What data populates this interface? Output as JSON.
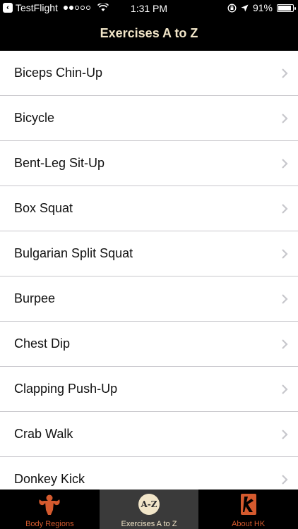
{
  "status_bar": {
    "back_app": "TestFlight",
    "time": "1:31 PM",
    "battery": "91%",
    "battery_level": 0.91
  },
  "nav": {
    "title": "Exercises A to Z"
  },
  "list": {
    "items": [
      "Biceps Chin-Up",
      "Bicycle",
      "Bent-Leg Sit-Up",
      "Box Squat",
      "Bulgarian Split Squat",
      "Burpee",
      "Chest Dip",
      "Clapping Push-Up",
      "Crab Walk",
      "Donkey Kick"
    ]
  },
  "tab_bar": {
    "tabs": [
      {
        "label": "Body Regions",
        "icon": "muscle-body-icon"
      },
      {
        "label": "Exercises A to Z",
        "icon": "a-z-icon",
        "badge": "A-Z"
      },
      {
        "label": "About HK",
        "icon": "hk-logo-icon"
      }
    ],
    "active_index": 1
  },
  "colors": {
    "accent": "#d45a2e",
    "cream": "#f1e5c8",
    "bar_background": "#000000",
    "active_tab_background": "#3a3a3a"
  }
}
